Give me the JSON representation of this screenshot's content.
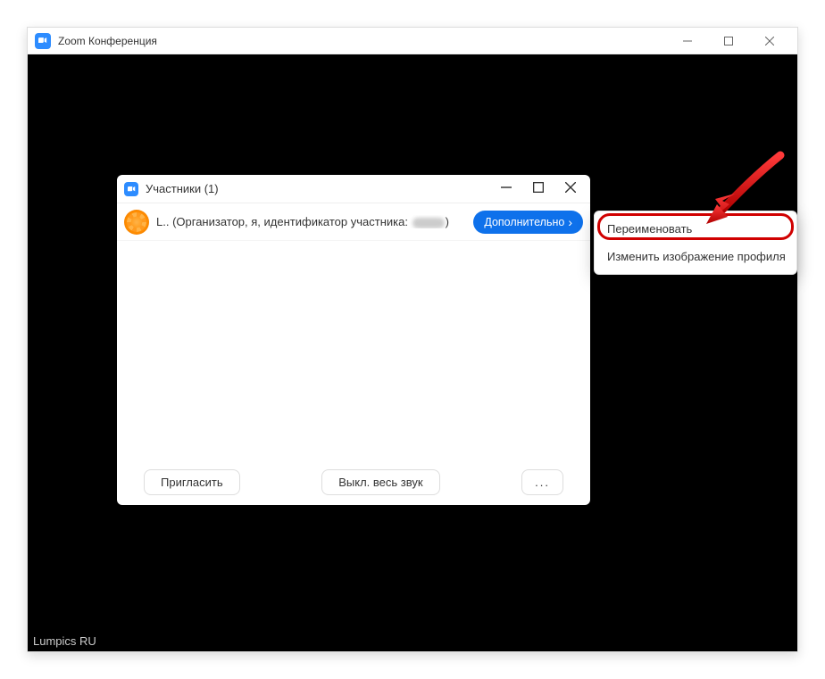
{
  "mainWindow": {
    "title": "Zoom Конференция"
  },
  "participantsWindow": {
    "title": "Участники (1)",
    "row": {
      "prefix": "L.. (Организатор, я, идентификатор участника: ",
      "suffix": ")",
      "moreLabel": "Дополнительно"
    },
    "footer": {
      "invite": "Пригласить",
      "muteAll": "Выкл. весь звук",
      "more": "..."
    }
  },
  "contextMenu": {
    "rename": "Переименовать",
    "changePicture": "Изменить изображение профиля"
  },
  "watermark": "Lumpics RU"
}
